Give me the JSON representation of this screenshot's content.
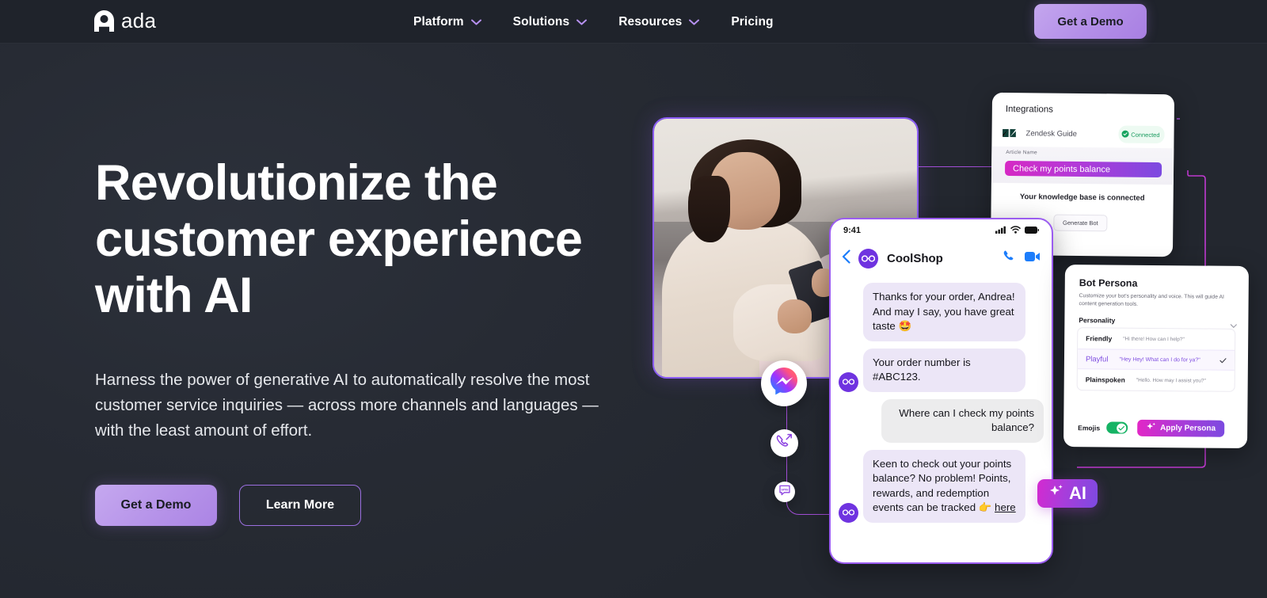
{
  "brand": {
    "name": "ada",
    "logo_icon": "ada-logo-icon"
  },
  "header": {
    "nav": [
      {
        "label": "Platform",
        "has_dropdown": true,
        "icon": "chevron-down-icon"
      },
      {
        "label": "Solutions",
        "has_dropdown": true,
        "icon": "chevron-down-icon"
      },
      {
        "label": "Resources",
        "has_dropdown": true,
        "icon": "chevron-down-icon"
      },
      {
        "label": "Pricing",
        "has_dropdown": false
      }
    ],
    "cta_label": "Get a Demo"
  },
  "hero": {
    "title": "Revolutionize the customer experience with AI",
    "subtitle": "Harness the power of generative AI to automatically resolve the most customer service inquiries — across more channels and languages — with the least amount of effort.",
    "primary_cta": "Get a Demo",
    "secondary_cta": "Learn More"
  },
  "integrations_card": {
    "title": "Integrations",
    "integration_name": "Zendesk Guide",
    "status_badge": "Connected",
    "field_label": "Article Name",
    "field_value": "Check my points balance",
    "knowledge_text": "Your knowledge base is connected",
    "generate_button": "Generate Bot"
  },
  "phone": {
    "status_time": "9:41",
    "contact_name": "CoolShop",
    "messages": [
      {
        "from": "bot",
        "text": "Thanks for your order, Andrea! And may I say, you have great taste 🤩",
        "show_avatar": false
      },
      {
        "from": "bot",
        "text": "Your order number is #ABC123.",
        "show_avatar": true
      },
      {
        "from": "user",
        "text": "Where can I check my points balance?",
        "show_avatar": false
      },
      {
        "from": "bot",
        "text": "Keen to check out your points balance? No problem! Points, rewards, and redemption events can be tracked 👉 ",
        "link_text": "here",
        "show_avatar": true
      }
    ]
  },
  "persona_card": {
    "title": "Bot Persona",
    "description": "Customize your bot's personality and voice. This will guide AI content generation tools.",
    "section_label": "Personality",
    "options": [
      {
        "name": "Friendly",
        "example": "\"Hi there! How can I help?\"",
        "selected": false
      },
      {
        "name": "Playful",
        "example": "\"Hey Hey! What can I do for ya?\"",
        "selected": true
      },
      {
        "name": "Plainspoken",
        "example": "\"Hello. How may I assist you?\"",
        "selected": false
      }
    ],
    "emojis_label": "Emojis",
    "emojis_enabled": true,
    "apply_button": "Apply Persona"
  },
  "ai_badge": {
    "label": "AI",
    "icon": "sparkle-icon"
  },
  "channels": [
    {
      "name": "messenger-icon"
    },
    {
      "name": "voice-forward-icon"
    },
    {
      "name": "sms-icon"
    }
  ],
  "colors": {
    "background": "#23272f",
    "header_bg": "#1f232b",
    "accent_purple": "#a87fe2",
    "wire_purple": "#a24ed6",
    "magenta": "#d628c4",
    "green": "#16b364"
  }
}
